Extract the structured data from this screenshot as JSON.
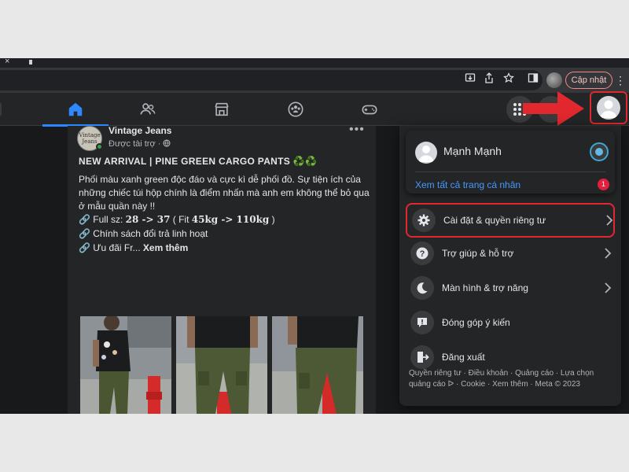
{
  "browser": {
    "close_glyph": "×",
    "update_button": "Cập nhật",
    "toolbar_icons": [
      "install-icon",
      "share-icon",
      "star-icon",
      "sidepanel-icon"
    ]
  },
  "nav": {
    "tabs": [
      "home-icon",
      "friends-icon",
      "marketplace-icon",
      "groups-icon",
      "gaming-icon"
    ],
    "active_tab": "home",
    "accent_color": "#2d88ff"
  },
  "post": {
    "page_name": "Vintage Jeans",
    "avatar_text": "Vintage Jeans",
    "sponsored": "Được tài trợ ·",
    "headline": "NEW ARRIVAL | PINE GREEN CARGO PANTS ♻️♻️",
    "body": "Phối màu xanh green độc đáo và cực kì dễ phối đồ. Sự tiện ích của những chiếc túi hộp chính là điểm nhấn mà anh em không thể bỏ qua ở mẫu quần này !!",
    "size_prefix": "🔗 Full sz: ",
    "size_range": "28 -> 37",
    "size_fit_open": " ( Fit ",
    "size_fit": "45kg -> 110kg",
    "size_fit_close": " )",
    "policy": "🔗 Chính sách đổi trả linh hoạt",
    "offer": "🔗 Ưu đãi Fr...",
    "see_more": "Xem thêm"
  },
  "menu": {
    "user_name": "Mạnh Mạnh",
    "see_all_profiles": "Xem tất cả trang cá nhân",
    "badge_count": "1",
    "items": [
      {
        "label": "Cài đặt & quyền riêng tư",
        "icon": "gear-icon",
        "chevron": true,
        "highlighted": true
      },
      {
        "label": "Trợ giúp & hỗ trợ",
        "icon": "help-icon",
        "chevron": true,
        "highlighted": false
      },
      {
        "label": "Màn hình & trợ năng",
        "icon": "moon-icon",
        "chevron": true,
        "highlighted": false
      },
      {
        "label": "Đóng góp ý kiến",
        "icon": "feedback-icon",
        "chevron": false,
        "highlighted": false
      },
      {
        "label": "Đăng xuất",
        "icon": "logout-icon",
        "chevron": false,
        "highlighted": false
      }
    ],
    "footer": "Quyền riêng tư · Điều khoản · Quảng cáo · Lựa chọn quảng cáo ᐅ · Cookie · Xem thêm · Meta © 2023",
    "footer_fragment": "····"
  },
  "annotation": {
    "highlight_color": "#e0282e"
  }
}
